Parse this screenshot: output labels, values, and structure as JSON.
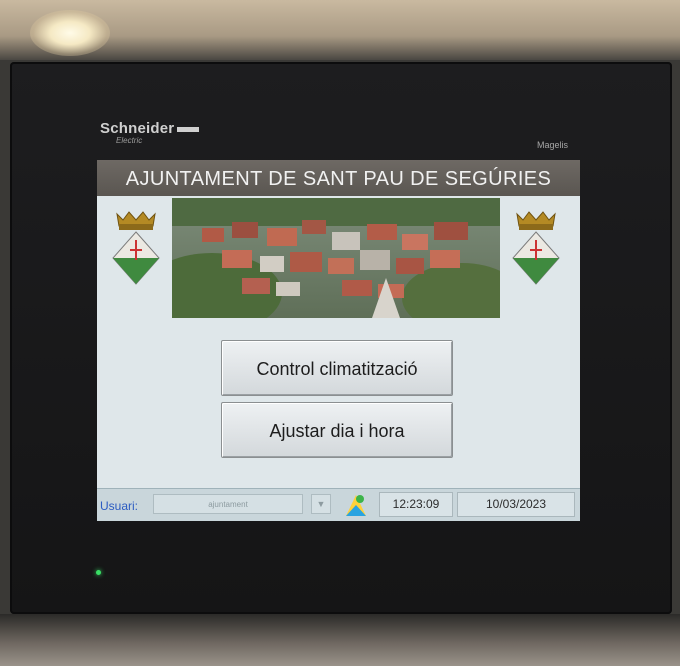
{
  "device": {
    "brand": "Schneider",
    "brand_sub": "Electric",
    "model": "Magelis"
  },
  "screen": {
    "title": "AJUNTAMENT DE SANT PAU DE SEGÚRIES",
    "buttons": {
      "climate_control": "Control climatització",
      "set_date_time": "Ajustar dia i hora"
    },
    "status_bar": {
      "user_label": "Usuari:",
      "user_value": "ajuntament",
      "time": "12:23:09",
      "date": "10/03/2023"
    }
  },
  "icons": {
    "crest_left": "coat-of-arms-icon",
    "crest_right": "coat-of-arms-icon",
    "user_dropdown": "chevron-down-icon",
    "login": "user-login-icon"
  },
  "colors": {
    "title_bar": "#5f5a55",
    "screen_bg": "#dfe7ea",
    "user_label": "#2c5cc2",
    "status_led": "#39e065"
  }
}
